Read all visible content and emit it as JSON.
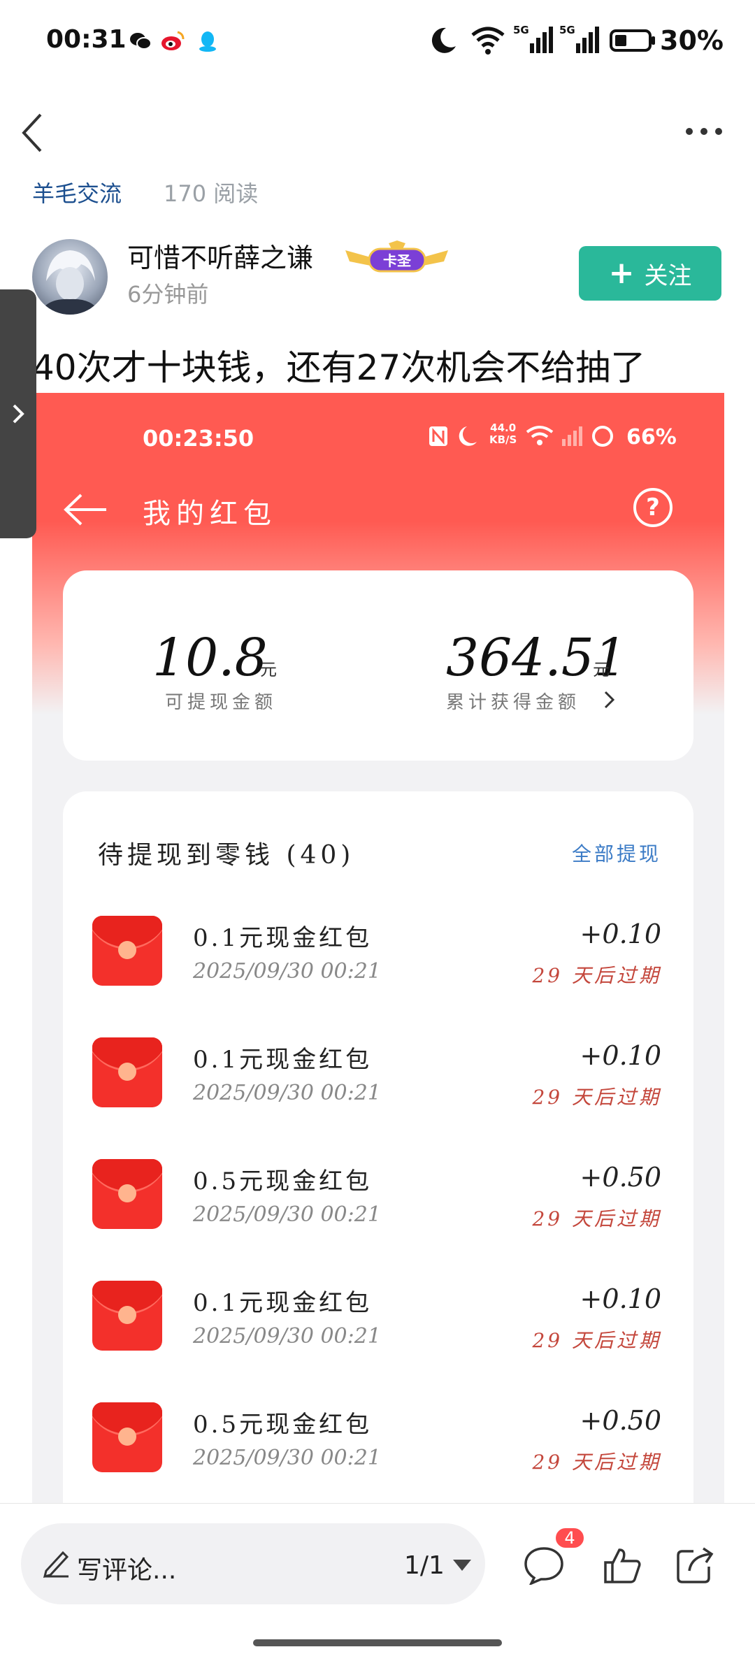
{
  "status_bar": {
    "time": "00:31",
    "network_1": "5G",
    "network_2": "5G",
    "battery": "30%"
  },
  "header": {
    "topic_tag": "羊毛交流",
    "read_count": "170 阅读"
  },
  "author": {
    "name": "可惜不听薛之谦",
    "badge": "卡圣",
    "time": "6分钟前",
    "follow_label": "关注"
  },
  "post": {
    "title": "40次才十块钱，还有27次机会不给抽了"
  },
  "screenshot": {
    "status_time": "00:23:50",
    "speed_value": "44.0",
    "speed_unit": "KB/S",
    "battery": "66%",
    "page_title": "我的红包",
    "help_glyph": "?",
    "summary": {
      "withdrawable_value": "10.8",
      "withdrawable_unit": "元",
      "withdrawable_label": "可提现金额",
      "total_value": "364.51",
      "total_unit": "元",
      "total_label": "累计获得金额"
    },
    "list": {
      "header": "待提现到零钱 (40)",
      "action": "全部提现",
      "items": [
        {
          "title": "0.1元现金红包",
          "date": "2025/09/30  00:21",
          "amount": "+0.10",
          "expiry": "29 天后过期"
        },
        {
          "title": "0.1元现金红包",
          "date": "2025/09/30  00:21",
          "amount": "+0.10",
          "expiry": "29 天后过期"
        },
        {
          "title": "0.5元现金红包",
          "date": "2025/09/30  00:21",
          "amount": "+0.50",
          "expiry": "29 天后过期"
        },
        {
          "title": "0.1元现金红包",
          "date": "2025/09/30  00:21",
          "amount": "+0.10",
          "expiry": "29 天后过期"
        },
        {
          "title": "0.5元现金红包",
          "date": "2025/09/30  00:21",
          "amount": "+0.50",
          "expiry": "29 天后过期"
        }
      ]
    }
  },
  "bottom_bar": {
    "comment_placeholder": "写评论...",
    "page_indicator": "1/1",
    "comment_count": "4"
  },
  "colors": {
    "accent_green": "#2ab89a",
    "red_header": "#ff5a52",
    "link_blue": "#3b7bc6",
    "expiry_red": "#c4473c"
  },
  "icons": [
    "wechat-icon",
    "weibo-icon",
    "qq-icon",
    "moon-icon",
    "wifi-icon",
    "signal-icon",
    "battery-icon",
    "back-icon",
    "more-icon",
    "chevron-right-icon",
    "help-icon",
    "red-envelope-icon",
    "pencil-icon",
    "dropdown-icon",
    "comment-icon",
    "like-icon",
    "share-icon"
  ]
}
